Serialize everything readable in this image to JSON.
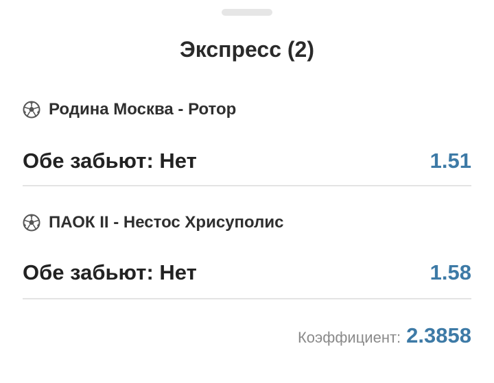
{
  "header": {
    "title": "Экспресс (2)"
  },
  "events": [
    {
      "icon": "soccer-ball-icon",
      "match": "Родина Москва - Ротор",
      "bet": "Обе забьют: Нет",
      "odds": "1.51"
    },
    {
      "icon": "soccer-ball-icon",
      "match": "ПАОК II - Нестос Хрисуполис",
      "bet": "Обе забьют: Нет",
      "odds": "1.58"
    }
  ],
  "summary": {
    "label": "Коэффициент:",
    "value": "2.3858"
  },
  "colors": {
    "accent": "#3d7aa6",
    "text": "#222222",
    "muted": "#8a8a8a",
    "divider": "#e3e3e3",
    "handle": "#e6e6e6"
  }
}
